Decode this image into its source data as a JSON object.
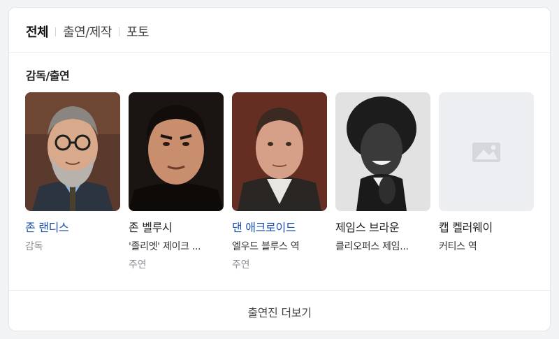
{
  "tabs": [
    {
      "label": "전체",
      "active": true
    },
    {
      "label": "출연/제작",
      "active": false
    },
    {
      "label": "포토",
      "active": false
    }
  ],
  "section_title": "감독/출연",
  "people": [
    {
      "name": "존 랜디스",
      "role": "감독",
      "sub": "",
      "linked": true,
      "photo": "john-landis-portrait"
    },
    {
      "name": "존 벨루시",
      "role": "'졸리엣' 제이크 ...",
      "sub": "주연",
      "linked": false,
      "photo": "john-belushi-portrait"
    },
    {
      "name": "댄 애크로이드",
      "role": "엘우드 블루스 역",
      "sub": "주연",
      "linked": true,
      "photo": "dan-aykroyd-portrait"
    },
    {
      "name": "제임스 브라운",
      "role": "클리오퍼스 제임...",
      "sub": "",
      "linked": false,
      "photo": "james-brown-portrait"
    },
    {
      "name": "캡 켈러웨이",
      "role": "커티스 역",
      "sub": "",
      "linked": false,
      "photo": "image-placeholder-icon"
    }
  ],
  "more_label": "출연진 더보기",
  "colors": {
    "link": "#1a4fb5",
    "muted": "#8a8d93",
    "placeholder": "#e9ebee"
  }
}
